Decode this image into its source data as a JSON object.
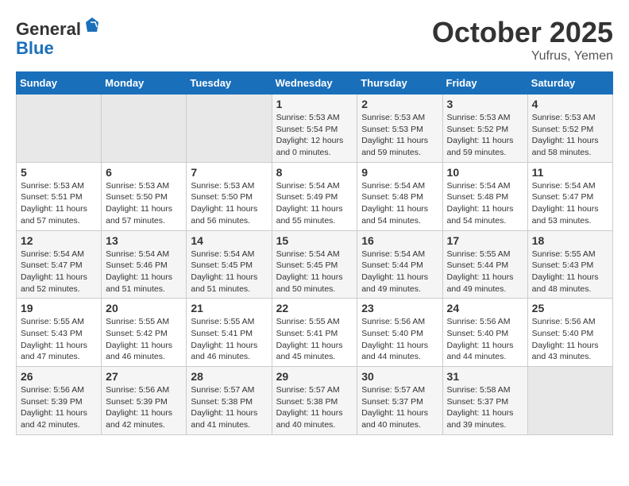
{
  "header": {
    "logo_general": "General",
    "logo_blue": "Blue",
    "month_title": "October 2025",
    "location": "Yufrus, Yemen"
  },
  "days_of_week": [
    "Sunday",
    "Monday",
    "Tuesday",
    "Wednesday",
    "Thursday",
    "Friday",
    "Saturday"
  ],
  "weeks": [
    [
      {
        "day": "",
        "info": ""
      },
      {
        "day": "",
        "info": ""
      },
      {
        "day": "",
        "info": ""
      },
      {
        "day": "1",
        "info": "Sunrise: 5:53 AM\nSunset: 5:54 PM\nDaylight: 12 hours and 0 minutes."
      },
      {
        "day": "2",
        "info": "Sunrise: 5:53 AM\nSunset: 5:53 PM\nDaylight: 11 hours and 59 minutes."
      },
      {
        "day": "3",
        "info": "Sunrise: 5:53 AM\nSunset: 5:52 PM\nDaylight: 11 hours and 59 minutes."
      },
      {
        "day": "4",
        "info": "Sunrise: 5:53 AM\nSunset: 5:52 PM\nDaylight: 11 hours and 58 minutes."
      }
    ],
    [
      {
        "day": "5",
        "info": "Sunrise: 5:53 AM\nSunset: 5:51 PM\nDaylight: 11 hours and 57 minutes."
      },
      {
        "day": "6",
        "info": "Sunrise: 5:53 AM\nSunset: 5:50 PM\nDaylight: 11 hours and 57 minutes."
      },
      {
        "day": "7",
        "info": "Sunrise: 5:53 AM\nSunset: 5:50 PM\nDaylight: 11 hours and 56 minutes."
      },
      {
        "day": "8",
        "info": "Sunrise: 5:54 AM\nSunset: 5:49 PM\nDaylight: 11 hours and 55 minutes."
      },
      {
        "day": "9",
        "info": "Sunrise: 5:54 AM\nSunset: 5:48 PM\nDaylight: 11 hours and 54 minutes."
      },
      {
        "day": "10",
        "info": "Sunrise: 5:54 AM\nSunset: 5:48 PM\nDaylight: 11 hours and 54 minutes."
      },
      {
        "day": "11",
        "info": "Sunrise: 5:54 AM\nSunset: 5:47 PM\nDaylight: 11 hours and 53 minutes."
      }
    ],
    [
      {
        "day": "12",
        "info": "Sunrise: 5:54 AM\nSunset: 5:47 PM\nDaylight: 11 hours and 52 minutes."
      },
      {
        "day": "13",
        "info": "Sunrise: 5:54 AM\nSunset: 5:46 PM\nDaylight: 11 hours and 51 minutes."
      },
      {
        "day": "14",
        "info": "Sunrise: 5:54 AM\nSunset: 5:45 PM\nDaylight: 11 hours and 51 minutes."
      },
      {
        "day": "15",
        "info": "Sunrise: 5:54 AM\nSunset: 5:45 PM\nDaylight: 11 hours and 50 minutes."
      },
      {
        "day": "16",
        "info": "Sunrise: 5:54 AM\nSunset: 5:44 PM\nDaylight: 11 hours and 49 minutes."
      },
      {
        "day": "17",
        "info": "Sunrise: 5:55 AM\nSunset: 5:44 PM\nDaylight: 11 hours and 49 minutes."
      },
      {
        "day": "18",
        "info": "Sunrise: 5:55 AM\nSunset: 5:43 PM\nDaylight: 11 hours and 48 minutes."
      }
    ],
    [
      {
        "day": "19",
        "info": "Sunrise: 5:55 AM\nSunset: 5:43 PM\nDaylight: 11 hours and 47 minutes."
      },
      {
        "day": "20",
        "info": "Sunrise: 5:55 AM\nSunset: 5:42 PM\nDaylight: 11 hours and 46 minutes."
      },
      {
        "day": "21",
        "info": "Sunrise: 5:55 AM\nSunset: 5:41 PM\nDaylight: 11 hours and 46 minutes."
      },
      {
        "day": "22",
        "info": "Sunrise: 5:55 AM\nSunset: 5:41 PM\nDaylight: 11 hours and 45 minutes."
      },
      {
        "day": "23",
        "info": "Sunrise: 5:56 AM\nSunset: 5:40 PM\nDaylight: 11 hours and 44 minutes."
      },
      {
        "day": "24",
        "info": "Sunrise: 5:56 AM\nSunset: 5:40 PM\nDaylight: 11 hours and 44 minutes."
      },
      {
        "day": "25",
        "info": "Sunrise: 5:56 AM\nSunset: 5:40 PM\nDaylight: 11 hours and 43 minutes."
      }
    ],
    [
      {
        "day": "26",
        "info": "Sunrise: 5:56 AM\nSunset: 5:39 PM\nDaylight: 11 hours and 42 minutes."
      },
      {
        "day": "27",
        "info": "Sunrise: 5:56 AM\nSunset: 5:39 PM\nDaylight: 11 hours and 42 minutes."
      },
      {
        "day": "28",
        "info": "Sunrise: 5:57 AM\nSunset: 5:38 PM\nDaylight: 11 hours and 41 minutes."
      },
      {
        "day": "29",
        "info": "Sunrise: 5:57 AM\nSunset: 5:38 PM\nDaylight: 11 hours and 40 minutes."
      },
      {
        "day": "30",
        "info": "Sunrise: 5:57 AM\nSunset: 5:37 PM\nDaylight: 11 hours and 40 minutes."
      },
      {
        "day": "31",
        "info": "Sunrise: 5:58 AM\nSunset: 5:37 PM\nDaylight: 11 hours and 39 minutes."
      },
      {
        "day": "",
        "info": ""
      }
    ]
  ]
}
